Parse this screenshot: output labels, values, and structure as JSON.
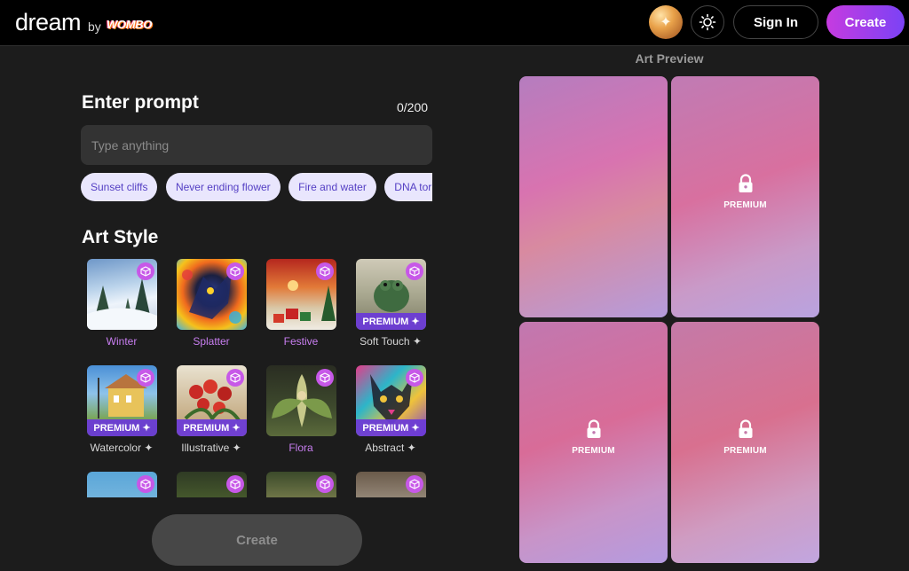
{
  "header": {
    "logo": "dream",
    "by": "by",
    "brand": "WOMBO",
    "sign_in": "Sign In",
    "create": "Create"
  },
  "prompt": {
    "title": "Enter prompt",
    "counter": "0/200",
    "placeholder": "Type anything",
    "suggestions": [
      "Sunset cliffs",
      "Never ending flower",
      "Fire and water",
      "DNA tornado"
    ]
  },
  "art_style": {
    "title": "Art Style",
    "styles": [
      {
        "label": "Winter",
        "premium": false
      },
      {
        "label": "Splatter",
        "premium": false
      },
      {
        "label": "Festive",
        "premium": false
      },
      {
        "label": "Soft Touch ✦",
        "premium": true
      },
      {
        "label": "Watercolor ✦",
        "premium": true
      },
      {
        "label": "Illustrative ✦",
        "premium": true
      },
      {
        "label": "Flora",
        "premium": false
      },
      {
        "label": "Abstract ✦",
        "premium": true
      }
    ],
    "premium_badge": "PREMIUM ✦"
  },
  "create_button": "Create",
  "preview": {
    "title": "Art Preview",
    "locked_label": "PREMIUM"
  },
  "colors": {
    "accent_gradient_start": "#c63be0",
    "accent_gradient_end": "#7b42f5",
    "chip_bg": "#e9e6fd",
    "chip_text": "#5540c4",
    "premium_badge": "#6b3bd6"
  }
}
